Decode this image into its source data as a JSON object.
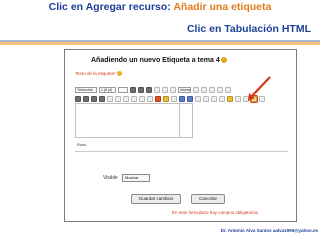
{
  "slide": {
    "title_part1": "Clic en Agregar recurso:",
    "title_part2": "Añadir una etiqueta",
    "subtitle": "Clic en Tabulación HTML",
    "footer": "Dr. Antonio Alva Santos aalva1959@yahoo.es"
  },
  "editor_page": {
    "heading": "Añadiendo un nuevo Etiqueta a tema 4",
    "field_label": "Texto de la etiqueta*",
    "toolbar": {
      "font_family": "Trebuchet",
      "font_size": "1 (8 pt)",
      "language": "Idioma"
    },
    "path_label": "Ruta:",
    "visible_label": "Visible",
    "visible_value": "Mostrar",
    "save_button": "Guardar cambios",
    "cancel_button": "Cancelar",
    "required_note": "En este formulario hay campos obligatorios"
  },
  "colors": {
    "title_blue": "#1c3f97",
    "title_orange": "#e07b1c",
    "arrow_red": "#d23a1a"
  }
}
